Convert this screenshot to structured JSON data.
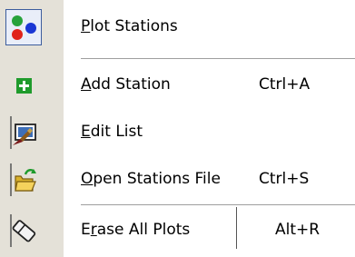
{
  "menu": {
    "items": [
      {
        "icon": "plot-stations-icon",
        "pre": "",
        "accel": "P",
        "post": "lot Stations",
        "shortcut": ""
      },
      {
        "icon": "add-station-icon",
        "pre": "",
        "accel": "A",
        "post": "dd Station",
        "shortcut": "Ctrl+A"
      },
      {
        "icon": "edit-list-icon",
        "pre": "",
        "accel": "E",
        "post": "dit List",
        "shortcut": ""
      },
      {
        "icon": "open-file-icon",
        "pre": "",
        "accel": "O",
        "post": "pen Stations File",
        "shortcut": "Ctrl+S"
      },
      {
        "icon": "eraser-icon",
        "pre": "E",
        "accel": "r",
        "post": "ase All Plots",
        "shortcut": "Alt+R"
      }
    ]
  },
  "colors": {
    "gutter": "#e4e1d8",
    "selected_border": "#3c5d9d",
    "selected_fill": "#e9eef9",
    "add_green": "#1f9b2c",
    "dot_green": "#27a23b",
    "dot_red": "#e0231b",
    "dot_blue": "#1a37d4"
  }
}
